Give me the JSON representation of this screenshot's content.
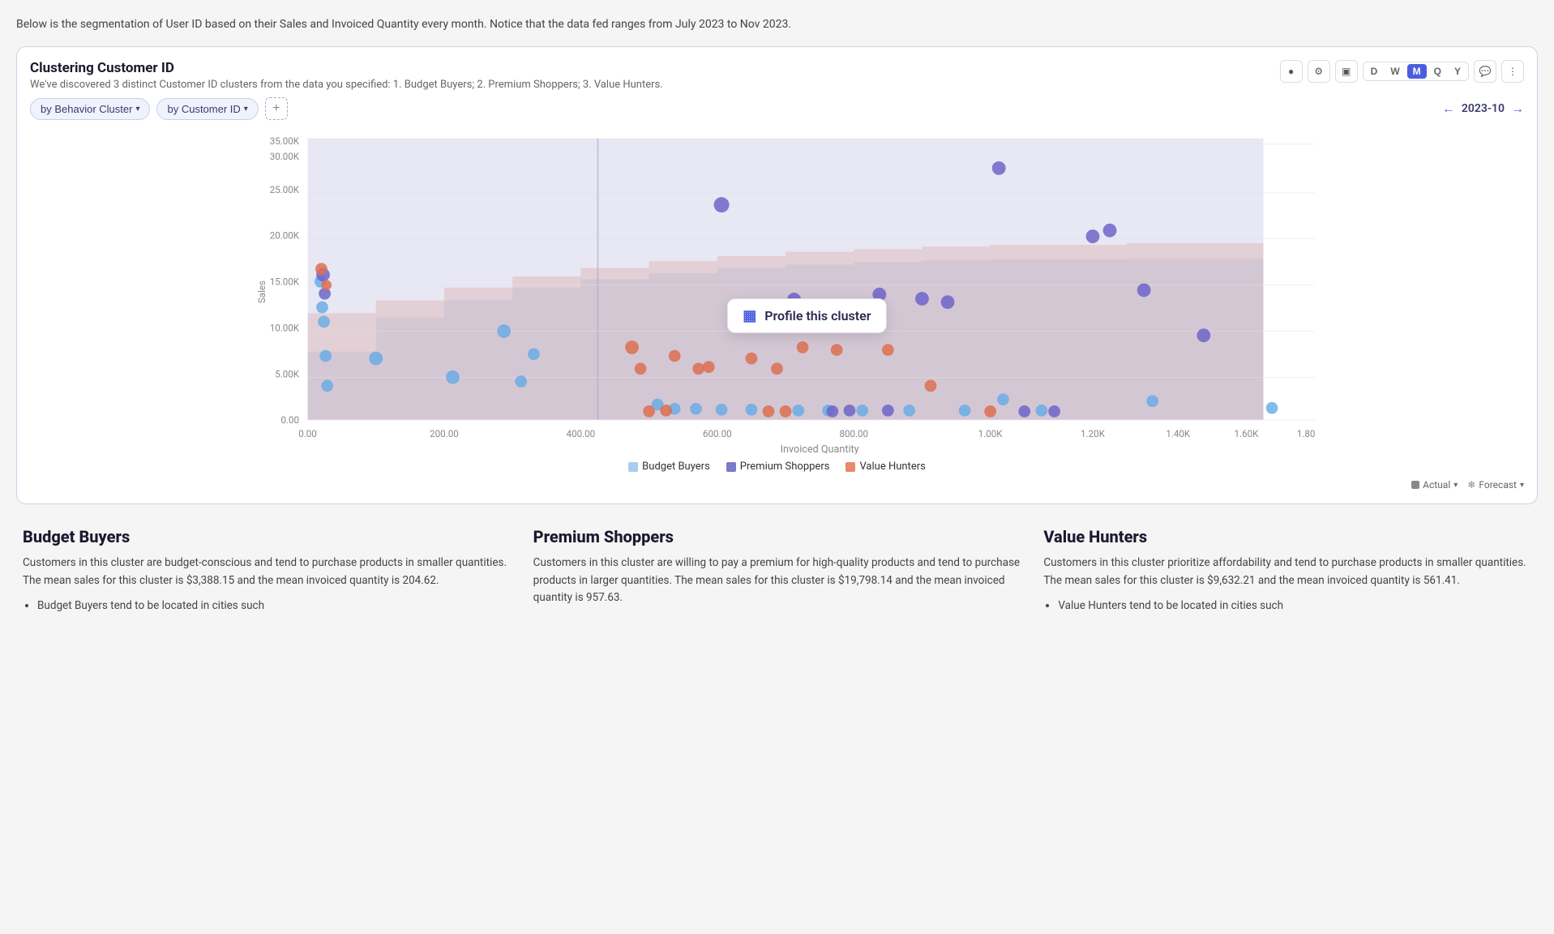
{
  "page": {
    "description": "Below is the segmentation of User ID based on their Sales and Invoiced Quantity every month. Notice that the data fed ranges from July 2023 to Nov 2023.",
    "card": {
      "title": "Clustering Customer ID",
      "subtitle": "We've discovered 3 distinct Customer ID clusters from the data you specified: 1. Budget Buyers; 2. Premium Shoppers; 3. Value Hunters.",
      "toolbar": {
        "tab1_label": "by Behavior Cluster",
        "tab2_label": "by Customer ID",
        "add_label": "+",
        "date_label": "2023-10"
      },
      "period_buttons": [
        "D",
        "W",
        "M",
        "Q",
        "Y"
      ],
      "active_period": "M",
      "tooltip_text": "Profile this cluster",
      "legend": [
        {
          "label": "Budget Buyers",
          "color": "#a8cdf0"
        },
        {
          "label": "Premium Shoppers",
          "color": "#7a7acc"
        },
        {
          "label": "Value Hunters",
          "color": "#e8896a"
        }
      ],
      "bottom_bar": {
        "actual_label": "Actual",
        "forecast_label": "Forecast"
      }
    },
    "clusters": [
      {
        "name": "Budget Buyers",
        "description": "Customers in this cluster are budget-conscious and tend to purchase products in smaller quantities. The mean sales for this cluster is $3,388.15 and the mean invoiced quantity is 204.62.",
        "bullet": "Budget Buyers tend to be located in cities such"
      },
      {
        "name": "Premium Shoppers",
        "description": "Customers in this cluster are willing to pay a premium for high-quality products and tend to purchase products in larger quantities. The mean sales for this cluster is $19,798.14 and the mean invoiced quantity is 957.63.",
        "bullet": null
      },
      {
        "name": "Value Hunters",
        "description": "Customers in this cluster prioritize affordability and tend to purchase products in smaller quantities. The mean sales for this cluster is $9,632.21 and the mean invoiced quantity is 561.41.",
        "bullet": "Value Hunters tend to be located in cities such"
      }
    ]
  },
  "icons": {
    "circle": "●",
    "gear": "⚙",
    "window": "▣",
    "chevron_down": "▾",
    "chevron_left": "←",
    "chevron_right": "→",
    "chat": "💬",
    "more": "⋮",
    "bar_chart": "▦",
    "snowflake": "❄"
  }
}
